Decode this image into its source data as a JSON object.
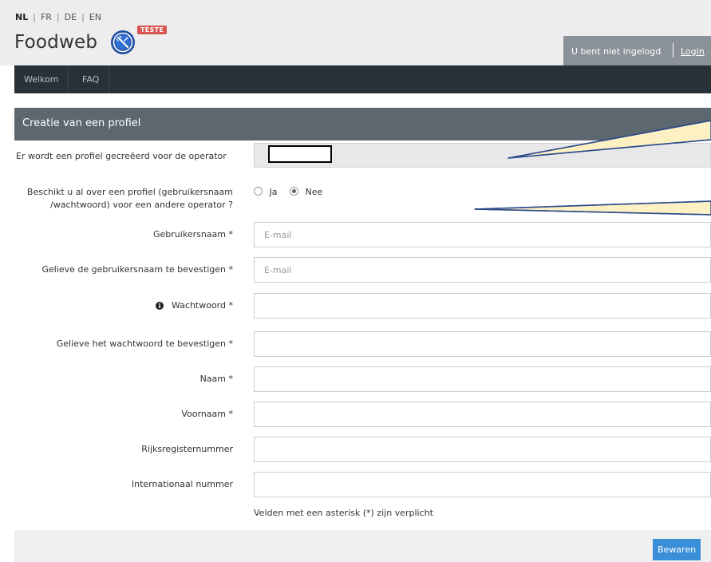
{
  "languages": [
    {
      "code": "NL",
      "active": true
    },
    {
      "code": "FR",
      "active": false
    },
    {
      "code": "DE",
      "active": false
    },
    {
      "code": "EN",
      "active": false
    }
  ],
  "brand": {
    "name": "Foodweb",
    "badge": "TESTE"
  },
  "account": {
    "status": "U bent niet ingelogd",
    "login": "Login"
  },
  "nav": {
    "items": [
      "Welkom",
      "FAQ"
    ]
  },
  "panel": {
    "title": "Creatie van een profiel"
  },
  "form": {
    "operator_label": "Er wordt een profiel gecreëerd voor de operator",
    "existing_label_line1": "Beschikt u al over een profiel (gebruikersnaam",
    "existing_label_line2": "/wachtwoord) voor een andere operator ?",
    "radio_yes": "Ja",
    "radio_no": "Nee",
    "radio_selected": "Nee",
    "username_label": "Gebruikersnaam *",
    "username_placeholder": "E-mail",
    "username_confirm_label": "Gelieve de gebruikersnaam te bevestigen *",
    "username_confirm_placeholder": "E-mail",
    "password_label": "Wachtwoord *",
    "password_confirm_label": "Gelieve het wachtwoord te bevestigen *",
    "lastname_label": "Naam *",
    "firstname_label": "Voornaam *",
    "national_number_label": "Rijksregisternummer",
    "international_number_label": "Internationaal nummer",
    "required_note": "Velden met een asterisk (*) zijn verplicht"
  },
  "actions": {
    "save": "Bewaren"
  },
  "colors": {
    "navbar": "#283038",
    "panel_header": "#5c6770",
    "save_button": "#3b8fd9",
    "badge": "#d9534f",
    "callout_fill": "#fdf0c2",
    "callout_stroke": "#2b4a8c"
  }
}
